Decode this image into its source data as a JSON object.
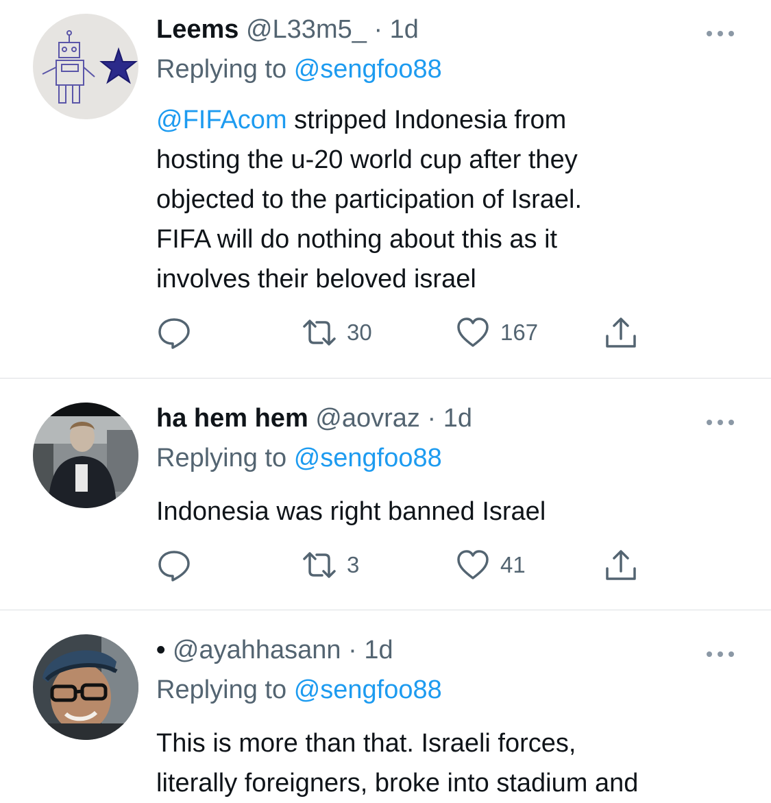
{
  "tweets": [
    {
      "display_name": "Leems",
      "handle": "@L33m5_",
      "separator": "·",
      "time": "1d",
      "replying_prefix": "Replying to",
      "replying_to": "@sengfoo88",
      "mention": "@FIFAcom",
      "text": " stripped Indonesia from\nhosting the u-20 world cup after they\nobjected to the participation of Israel.\nFIFA will do nothing about this as it\ninvolves their beloved israel",
      "retweets": "30",
      "likes": "167",
      "avatar_icon": "robot-drawing-avatar"
    },
    {
      "display_name": "ha hem hem",
      "handle": "@aovraz",
      "separator": "·",
      "time": "1d",
      "replying_prefix": "Replying to",
      "replying_to": "@sengfoo88",
      "text": "Indonesia was right banned Israel",
      "retweets": "3",
      "likes": "41",
      "avatar_icon": "person-photo-avatar"
    },
    {
      "display_name": "•",
      "handle": "@ayahhasann",
      "separator": "·",
      "time": "1d",
      "replying_prefix": "Replying to",
      "replying_to": "@sengfoo88",
      "text": "This is more than that. Israeli forces,\nliterally foreigners, broke into stadium and",
      "avatar_icon": "person-with-cap-avatar"
    }
  ],
  "colors": {
    "link": "#1d9bf0",
    "secondary_text": "#536471",
    "primary_text": "#0f1419",
    "divider": "#dcdfe2"
  }
}
